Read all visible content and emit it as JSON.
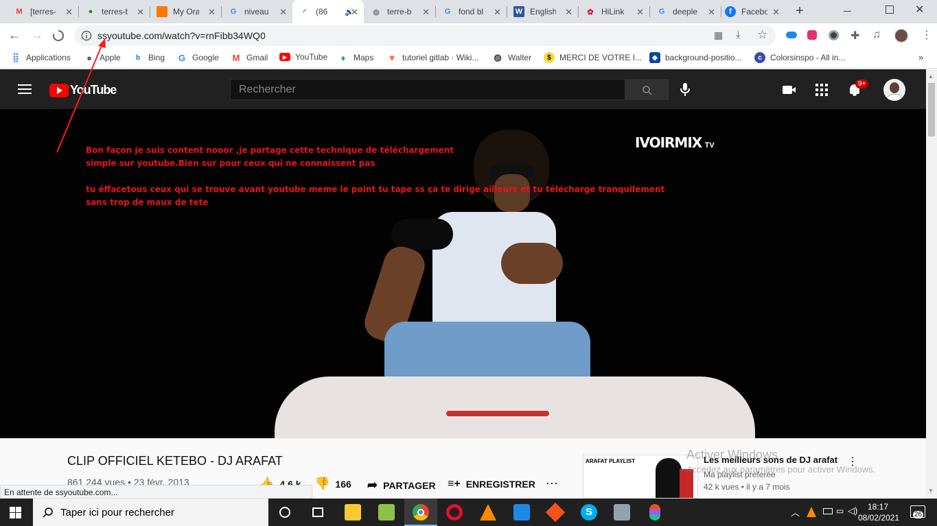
{
  "browser": {
    "tabs": [
      {
        "title": "[terres-",
        "icon": "gmail-icon",
        "color": "#ea4335"
      },
      {
        "title": "terres-b",
        "icon": "earth-icon",
        "color": "#2e7d32"
      },
      {
        "title": "My Ora",
        "icon": "orange-icon",
        "color": "#ff7900"
      },
      {
        "title": "niveau",
        "icon": "google-icon",
        "color": "#4285f4"
      },
      {
        "title": "(86",
        "icon": "loading-icon",
        "color": "#5f6368",
        "active": true
      },
      {
        "title": "terre-b",
        "icon": "globe-icon",
        "color": "#80868b"
      },
      {
        "title": "fond bl",
        "icon": "google-icon",
        "color": "#4285f4"
      },
      {
        "title": "English",
        "icon": "word-icon",
        "color": "#2b579a"
      },
      {
        "title": "HiLink",
        "icon": "huawei-icon",
        "color": "#cf0a2c"
      },
      {
        "title": "deeple",
        "icon": "google-icon",
        "color": "#4285f4"
      },
      {
        "title": "Facebo",
        "icon": "facebook-icon",
        "color": "#1877f2"
      }
    ],
    "url": "ssyoutube.com/watch?v=rnFibb34WQ0",
    "bookmarks": [
      {
        "label": "Applications"
      },
      {
        "label": "Apple"
      },
      {
        "label": "Bing"
      },
      {
        "label": "Google"
      },
      {
        "label": "Gmail"
      },
      {
        "label": "YouTube"
      },
      {
        "label": "Maps"
      },
      {
        "label": "tutoriel gitlab · Wiki..."
      },
      {
        "label": "Walter"
      },
      {
        "label": "MERCI DE VOTRE I..."
      },
      {
        "label": "background-positio..."
      },
      {
        "label": "Colorsinspo - All in..."
      }
    ],
    "status_text": "En attente de ssyoutube.com..."
  },
  "youtube": {
    "logo": "YouTube",
    "search_placeholder": "Rechercher",
    "notification_count": "9+",
    "video": {
      "watermark": "IVOIRMIX",
      "watermark_sub": "TV",
      "note_lines": [
        "Bon façon je suis content nooor ,je partage cette technique de téléchargement",
        "simple sur youtube.Bien sur pour ceux qui ne connaissent pas",
        "tu éffacetous ceux qui se trouve avant youtube meme le point tu tape ss ça te dirige ailleurs et tu télécharge tranquilement",
        "sans trop de maux de tete"
      ]
    },
    "title": "CLIP OFFICIEL KETEBO - DJ ARAFAT",
    "views_date": "861 244 vues • 23 févr. 2013",
    "likes": "4,6 k",
    "dislikes": "166",
    "share_label": "PARTAGER",
    "save_label": "ENREGISTRER",
    "playlist": {
      "thumb_label": "ARAFAT PLAYLIST",
      "title": "Les meilleurs sons de DJ arafat",
      "subtitle": "Ma playlist preferée",
      "meta": "42 k vues • il y a 7 mois"
    },
    "activate_title": "Activer Windows",
    "activate_sub": "Accédez aux paramètres pour activer Windows."
  },
  "taskbar": {
    "search_placeholder": "Taper ici pour rechercher",
    "time": "18:17",
    "date": "08/02/2021",
    "notification_count": "26"
  }
}
